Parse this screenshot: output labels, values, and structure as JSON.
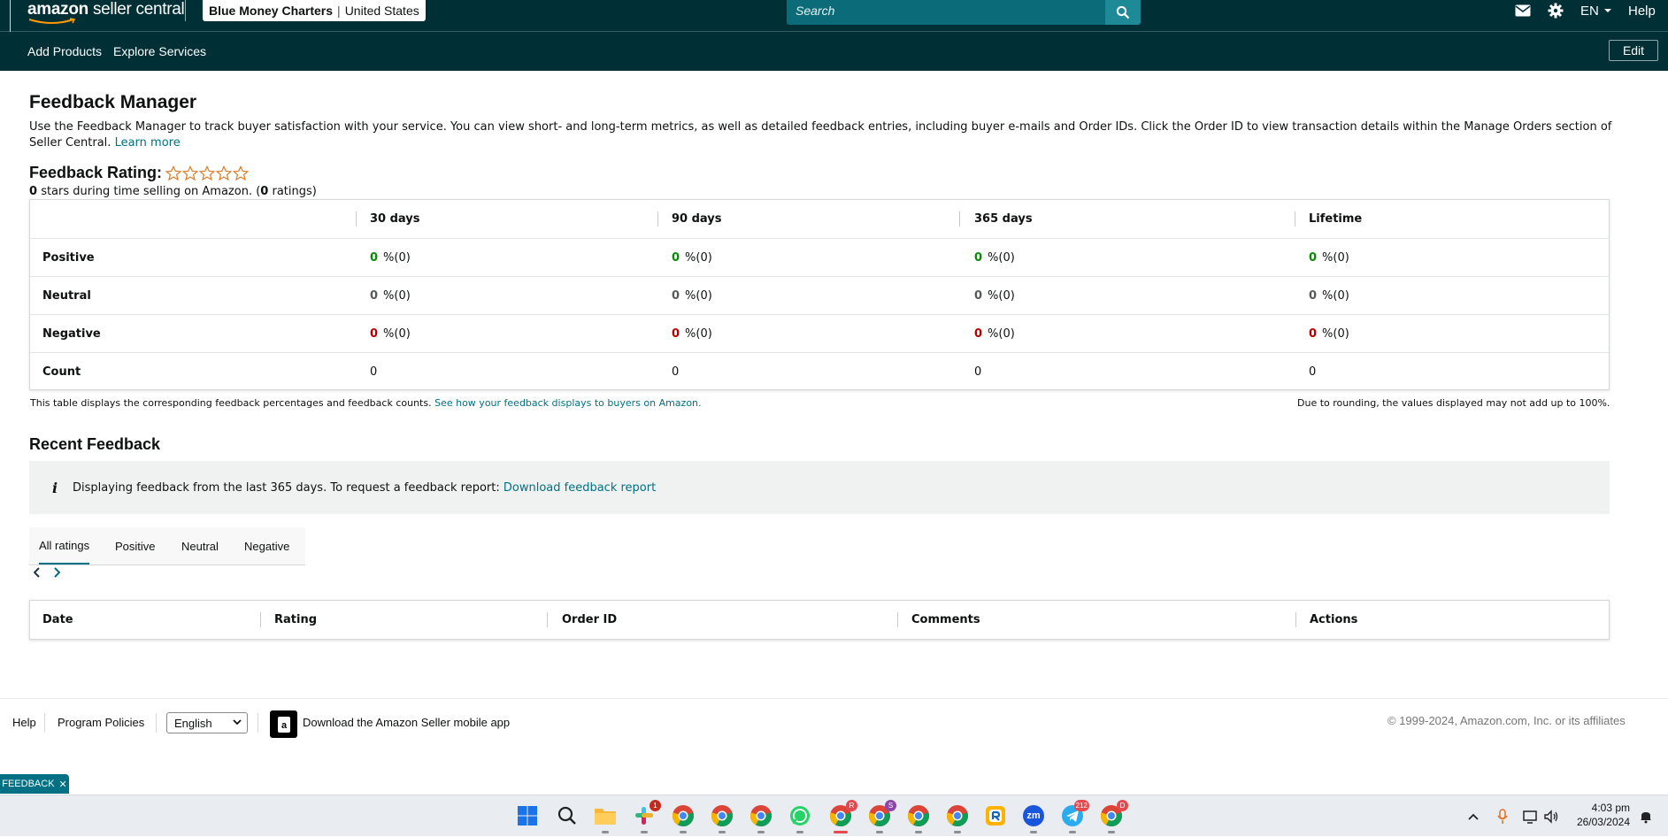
{
  "header": {
    "logo_brand": "amazon",
    "logo_suffix": "seller central",
    "account_name": "Blue Money Charters",
    "account_sep": "|",
    "account_region": "United States",
    "search_placeholder": "Search",
    "language": "EN",
    "help": "Help"
  },
  "nav": {
    "items": [
      {
        "label": "Add Products"
      },
      {
        "label": "Explore Services"
      }
    ],
    "edit_label": "Edit"
  },
  "page": {
    "title": "Feedback Manager",
    "intro_text": "Use the Feedback Manager to track buyer satisfaction with your service. You can view short- and long-term metrics, as well as detailed feedback entries, including buyer e-mails and Order IDs. Click the Order ID to view transaction details within the Manage Orders section of Seller Central.",
    "learn_more": "Learn more"
  },
  "rating": {
    "heading": "Feedback Rating:",
    "stars_filled": 0,
    "stars_total": 5,
    "stars_value": "0",
    "summary_mid": "stars during time selling on Amazon. (",
    "count_value": "0",
    "summary_end": "ratings)"
  },
  "feedback_table": {
    "columns": [
      "30 days",
      "90 days",
      "365 days",
      "Lifetime"
    ],
    "rows": [
      {
        "label": "Positive",
        "kind": "pos",
        "values": [
          {
            "n": "0",
            "p": "%(0)"
          },
          {
            "n": "0",
            "p": "%(0)"
          },
          {
            "n": "0",
            "p": "%(0)"
          },
          {
            "n": "0",
            "p": "%(0)"
          }
        ]
      },
      {
        "label": "Neutral",
        "kind": "neu",
        "values": [
          {
            "n": "0",
            "p": "%(0)"
          },
          {
            "n": "0",
            "p": "%(0)"
          },
          {
            "n": "0",
            "p": "%(0)"
          },
          {
            "n": "0",
            "p": "%(0)"
          }
        ]
      },
      {
        "label": "Negative",
        "kind": "neg",
        "values": [
          {
            "n": "0",
            "p": "%(0)"
          },
          {
            "n": "0",
            "p": "%(0)"
          },
          {
            "n": "0",
            "p": "%(0)"
          },
          {
            "n": "0",
            "p": "%(0)"
          }
        ]
      },
      {
        "label": "Count",
        "kind": "count",
        "values": [
          {
            "n": "0"
          },
          {
            "n": "0"
          },
          {
            "n": "0"
          },
          {
            "n": "0"
          }
        ]
      }
    ],
    "note_left": "This table displays the corresponding feedback percentages and feedback counts.",
    "note_link": "See how your feedback displays to buyers on Amazon.",
    "note_right": "Due to rounding, the values displayed may not add up to 100%."
  },
  "recent": {
    "heading": "Recent Feedback",
    "info_text": "Displaying feedback from the last 365 days. To request a feedback report:",
    "info_link": "Download feedback report",
    "tabs": [
      "All ratings",
      "Positive",
      "Neutral",
      "Negative"
    ],
    "active_tab": "All ratings",
    "columns": [
      "Date",
      "Rating",
      "Order ID",
      "Comments",
      "Actions"
    ]
  },
  "footer": {
    "help": "Help",
    "program_policies": "Program Policies",
    "language_selected": "English",
    "app_download": "Download the Amazon Seller mobile app",
    "copyright": "© 1999-2024, Amazon.com, Inc. or its affiliates"
  },
  "feedback_tab": {
    "label": "FEEDBACK",
    "close": "✕"
  },
  "taskbar": {
    "badges": {
      "slack": "1",
      "chrome_r": "R",
      "chrome_s": "S",
      "telegram": "212",
      "chrome_d": "D"
    },
    "zoom_label": "zm",
    "time": "4:03 pm",
    "date": "26/03/2024"
  },
  "colors": {
    "header_bg": "#002f36",
    "link": "#007185",
    "positive": "#068c06",
    "negative": "#b40000",
    "star_outline": "#de7921"
  }
}
